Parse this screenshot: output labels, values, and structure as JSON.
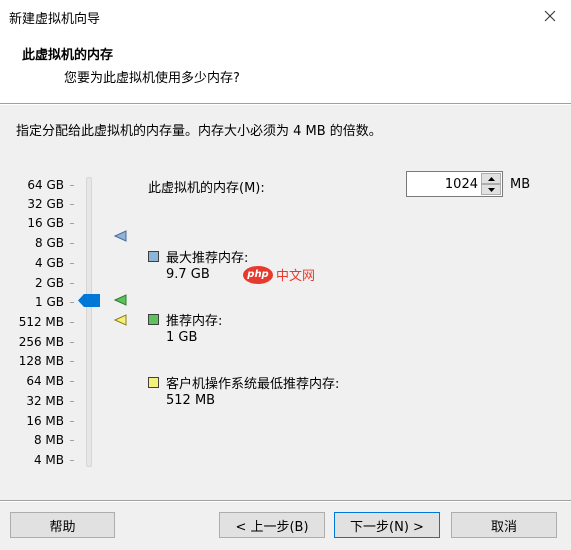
{
  "window": {
    "title": "新建虚拟机向导"
  },
  "header": {
    "title": "此虚拟机的内存",
    "subtitle": "您要为此虚拟机使用多少内存?"
  },
  "description": "指定分配给此虚拟机的内存量。内存大小必须为 4 MB 的倍数。",
  "scale": {
    "labels": [
      "64 GB",
      "32 GB",
      "16 GB",
      "8 GB",
      "4 GB",
      "2 GB",
      "1 GB",
      "512 MB",
      "256 MB",
      "128 MB",
      "64 MB",
      "32 MB",
      "16 MB",
      "8 MB",
      "4 MB"
    ],
    "selected": "1 GB"
  },
  "memory": {
    "label": "此虚拟机的内存(M):",
    "value": "1024",
    "unit": "MB"
  },
  "legend": {
    "max": {
      "title": "最大推荐内存:",
      "value": "9.7 GB",
      "color": "#8fb4d9"
    },
    "recommended": {
      "title": "推荐内存:",
      "value": "1 GB",
      "color": "#5cc35c"
    },
    "min": {
      "title": "客户机操作系统最低推荐内存:",
      "value": "512 MB",
      "color": "#f5f07a"
    }
  },
  "watermark": {
    "logo": "php",
    "text": "中文网"
  },
  "buttons": {
    "help": "帮助",
    "back": "< 上一步(B)",
    "next": "下一步(N) >",
    "cancel": "取消"
  },
  "colors": {
    "thumb": "#0078d7",
    "marker_max": "#6a8fc0",
    "marker_rec": "#4caf50",
    "marker_min": "#e6d84a"
  }
}
